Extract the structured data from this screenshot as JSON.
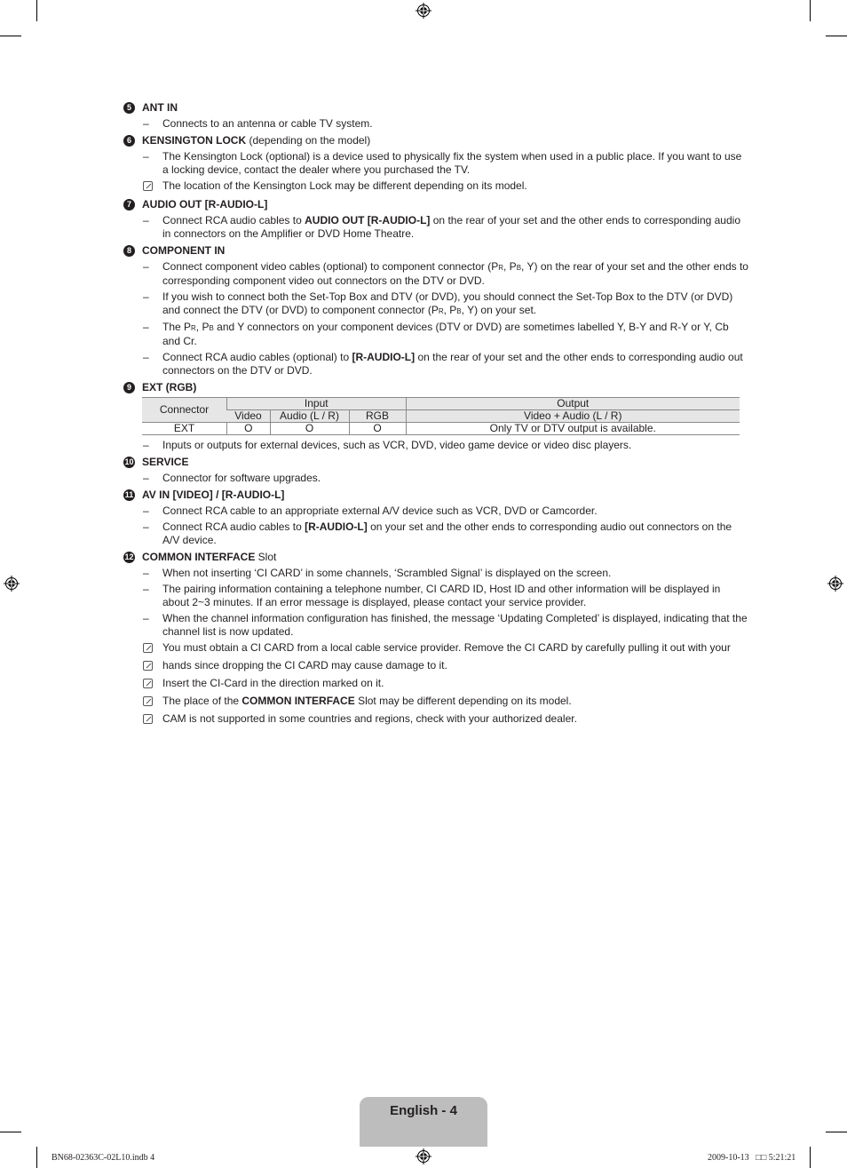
{
  "sections": [
    {
      "num": "5",
      "title": "ANT IN",
      "suffix": "",
      "items": [
        {
          "type": "dash",
          "html": "Connects to an antenna or cable TV system."
        }
      ]
    },
    {
      "num": "6",
      "title": "KENSINGTON LOCK",
      "suffix": " (depending on the model)",
      "items": [
        {
          "type": "dash",
          "html": "The Kensington Lock (optional) is a device used to physically fix the system when used in a public place. If you want to use a locking device, contact the dealer where you purchased the TV."
        },
        {
          "type": "note",
          "html": "The location of the Kensington Lock may be different depending on its model."
        }
      ]
    },
    {
      "num": "7",
      "title": "AUDIO OUT [R-AUDIO-L]",
      "suffix": "",
      "items": [
        {
          "type": "dash",
          "html": "Connect RCA audio cables to <b>AUDIO OUT [R-AUDIO-L]</b> on the rear of your set and the other ends to corresponding audio in connectors on the Amplifier or DVD Home Theatre."
        }
      ]
    },
    {
      "num": "8",
      "title": "COMPONENT IN",
      "suffix": "",
      "items": [
        {
          "type": "dash",
          "html": "Connect component video cables (optional) to component connector (P<span class=\"sub\">R</span>, P<span class=\"sub\">B</span>, Y) on the rear of your set and the other ends to corresponding component video out connectors on the DTV or DVD."
        },
        {
          "type": "dash",
          "html": "If you wish to connect both the Set-Top Box and DTV (or DVD), you should connect the Set-Top Box to the DTV (or DVD) and connect the DTV (or DVD) to component connector (P<span class=\"sub\">R</span>, P<span class=\"sub\">B</span>, Y) on your set."
        },
        {
          "type": "dash",
          "html": "The P<span class=\"sub\">R</span>, P<span class=\"sub\">B</span> and Y connectors on your component devices (DTV or DVD) are sometimes labelled Y, B-Y and R-Y or Y, Cb and Cr."
        },
        {
          "type": "dash",
          "html": "Connect RCA audio cables (optional) to <b>[R-AUDIO-L]</b> on the rear of your set and the other ends to corresponding audio out connectors on the DTV or DVD."
        }
      ]
    },
    {
      "num": "9",
      "title": "EXT (RGB)",
      "suffix": "",
      "has_table": true,
      "items": [
        {
          "type": "dash",
          "html": "Inputs or outputs for external devices, such as VCR, DVD, video game device or video disc players."
        }
      ]
    },
    {
      "num": "10",
      "title": "SERVICE",
      "suffix": "",
      "items": [
        {
          "type": "dash",
          "html": "Connector for software upgrades."
        }
      ]
    },
    {
      "num": "11",
      "title": "AV IN [VIDEO] / [R-AUDIO-L]",
      "suffix": "",
      "items": [
        {
          "type": "dash",
          "html": "Connect RCA cable to an appropriate external A/V device such as VCR, DVD or Camcorder."
        },
        {
          "type": "dash",
          "html": "Connect RCA audio cables to <b>[R-AUDIO-L]</b> on your set and the other ends to corresponding audio out connectors on the A/V device."
        }
      ]
    },
    {
      "num": "12",
      "title": "COMMON INTERFACE",
      "suffix": " Slot",
      "items": [
        {
          "type": "dash",
          "html": "When not inserting ‘CI CARD’ in some channels, ‘Scrambled Signal’ is displayed on the screen."
        },
        {
          "type": "dash",
          "html": "The pairing information containing a telephone number, CI CARD ID, Host ID and other information will be displayed in about 2~3 minutes. If an error message is displayed, please contact your service provider."
        },
        {
          "type": "dash",
          "html": "When the channel information configuration has finished, the message ‘Updating Completed’ is displayed, indicating that the channel list is now updated."
        },
        {
          "type": "note",
          "html": "You must obtain a CI CARD from a local cable service provider. Remove the CI CARD by carefully pulling it out with your"
        },
        {
          "type": "note",
          "html": "hands since dropping the CI CARD may cause damage to it."
        },
        {
          "type": "note",
          "html": "Insert the CI-Card in the direction marked on it."
        },
        {
          "type": "note",
          "html": "The place of the <b>COMMON INTERFACE</b> Slot may be different depending on its model."
        },
        {
          "type": "note",
          "html": "CAM is not supported in some countries and regions, check with your authorized dealer."
        }
      ]
    }
  ],
  "ext_table": {
    "header_connector": "Connector",
    "header_input": "Input",
    "header_output": "Output",
    "sub_video": "Video",
    "sub_audio": "Audio (L / R)",
    "sub_rgb": "RGB",
    "sub_output": "Video + Audio (L / R)",
    "row": {
      "connector": "EXT",
      "video": "O",
      "audio": "O",
      "rgb": "O",
      "output": "Only TV or DTV output is available."
    }
  },
  "dash_glyph": "–",
  "footer": {
    "page_label": "English - 4",
    "slug_left": "BN68-02363C-02L10.indb   4",
    "slug_right": "2009-10-13   □□ 5:21:21"
  }
}
